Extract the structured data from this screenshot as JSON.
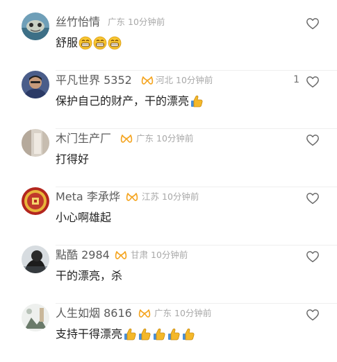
{
  "comments": [
    {
      "name": "丝竹怡情",
      "badge": false,
      "location": "广东",
      "time": "10分钟前",
      "text": "舒服",
      "emojis": [
        "grin-emoji",
        "grin-emoji",
        "grin-emoji"
      ],
      "likes": ""
    },
    {
      "name": "平凡世界 5352",
      "badge": true,
      "location": "河北",
      "time": "10分钟前",
      "text": "保护自己的财产，干的漂亮",
      "emojis": [
        "thumbs-up-emoji"
      ],
      "likes": "1"
    },
    {
      "name": "木门生产厂",
      "badge": true,
      "location": "广东",
      "time": "10分钟前",
      "text": "打得好",
      "emojis": [],
      "likes": ""
    },
    {
      "name": "Meta 李承烨",
      "badge": true,
      "location": "江苏",
      "time": "10分钟前",
      "text": "小心啊雄起",
      "emojis": [],
      "likes": ""
    },
    {
      "name": "點酷 2984",
      "badge": true,
      "location": "甘肃",
      "time": "10分钟前",
      "text": "干的漂亮，杀",
      "emojis": [],
      "likes": ""
    },
    {
      "name": "人生如烟 8616",
      "badge": true,
      "location": "广东",
      "time": "10分钟前",
      "text": "支持干得漂亮",
      "emojis": [
        "thumbs-up-emoji",
        "thumbs-up-emoji",
        "thumbs-up-emoji",
        "thumbs-up-emoji",
        "thumbs-up-emoji"
      ],
      "likes": ""
    }
  ],
  "colors": {
    "badge": "#f5a623",
    "name": "#5a5a5a",
    "meta": "#a8a8a8",
    "text": "#1f1f1f"
  }
}
